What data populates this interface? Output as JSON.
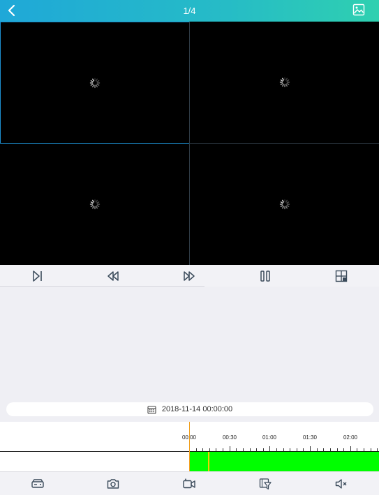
{
  "header": {
    "title": "1/4"
  },
  "icons": {
    "back": "chevron-left-icon",
    "gallery": "image-icon",
    "loading": "spinner-icon",
    "step": "step-forward-icon",
    "rewind": "rewind-icon",
    "fastforward": "fast-forward-icon",
    "pause": "pause-icon",
    "layout": "grid-layout-icon",
    "calendar": "calendar-icon",
    "storage": "storage-device-icon",
    "camera": "camera-icon",
    "record": "video-record-icon",
    "clip": "clip-filter-icon",
    "mute": "mute-icon"
  },
  "date": {
    "value": "2018-11-14 00:00:00"
  },
  "timeline": {
    "labels": [
      "00:00",
      "00:30",
      "01:00",
      "01:30",
      "02:00"
    ]
  },
  "colors": {
    "header_start": "#1fa8d8",
    "header_end": "#2fd0b0",
    "selected_border": "#1d8fd0",
    "recording": "#00ff00",
    "playhead": "#f0a020",
    "marker": "#f5d000"
  }
}
